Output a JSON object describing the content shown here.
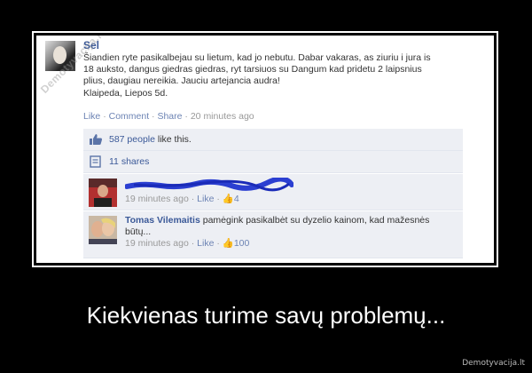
{
  "post": {
    "author": "Sel",
    "text_lines": [
      "Šiandien ryte pasikalbejau su lietum, kad jo nebutu. Dabar vakaras, as ziuriu i jura is",
      "18 auksto, dangus giedras giedras, ryt tarsiuos su Dangum kad pridetu 2 laipsnius",
      "plius, daugiau nereikia. Jauciu artejancia audra!",
      "Klaipeda, Liepos 5d."
    ],
    "actions": {
      "like": "Like",
      "comment": "Comment",
      "share": "Share",
      "time": "20 minutes ago",
      "sep": "·"
    }
  },
  "likes": {
    "count": "587 people",
    "suffix": " like this."
  },
  "shares": {
    "label": "11 shares"
  },
  "comments": [
    {
      "meta_time": "19 minutes ago",
      "like": "Like",
      "likes": "4"
    },
    {
      "name": "Tomas Vilemaitis",
      "text": "pamėgink pasikalbėt su dyzelio kainom, kad mažesnės būtų...",
      "meta_time": "19 minutes ago",
      "like": "Like",
      "likes": "100"
    }
  ],
  "watermark": "Demotyvacija.lt",
  "caption": "Kiekvienas turime savų problemų...",
  "credit": "Demotyvacija.lt",
  "colors": {
    "link": "#3b5998",
    "ufi_bg": "#edeff4",
    "background": "#000000"
  },
  "icons": [
    "thumbs-up-icon",
    "share-icon"
  ]
}
